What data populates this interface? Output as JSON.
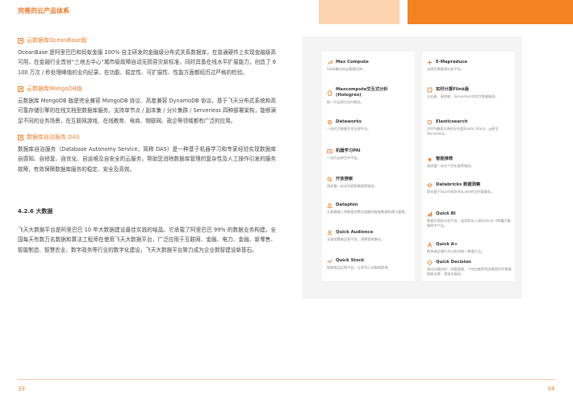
{
  "header": {
    "title": "完善的云产品体系"
  },
  "colors": {
    "accent": "#f07c28",
    "panel_bg": "#f4f4f4"
  },
  "left_column": {
    "sections": [
      {
        "heading": "云数据库OceanBase版",
        "body": "OceanBase 是阿里巴巴和蚂蚁金服 100% 自主研发的金融级分布式关系数据库，在普通硬件上实现金融级高可用，在金融行业首创“三地五中心”城市级故障自动无损容灾新标准，同时具备在线水平扩展能力，创造了 6100 万次 / 秒处理峰值的业内纪录，在功能、稳定性、可扩展性、性能方面都经历过严格的检验。"
      },
      {
        "heading": "云数据库MongoDB版",
        "body": "云数据库 MongoDB 版是完全兼容 MongoDB 协议、高度兼容 DynamoDB 协议，基于飞天分布式系统和高可靠存储引擎的在线文档型数据库服务，支持单节点 / 副本集 / 分片集群 / Serverless 四种部署架构，能够满足不同的业务场景，在互联网游戏、在线教育、电商、物联网、政企等领域都有广泛的应用。"
      },
      {
        "heading": "数据库自治服务 DAS",
        "body": "数据库自治服务（Database Autonomy Service，简称 DAS）是一种基于机器学习和专家经验实现数据库自感知、自修复、自优化、自运维及自安全的云服务，帮助您消除数据库管理的复杂性及人工操作引发的服务故障，有效保障数据库服务的稳定、安全及高效。"
      }
    ],
    "subsection": {
      "title": "4.2.6 大数据",
      "body": "飞天大数据平台是阿里巴巴 10 年大数据建设最佳实践的结晶。它承载了阿里巴巴 99% 的数据业务构建。全国每天有数万名数据和算法工程师在使用飞天大数据平台，广泛应用于互联网、金融、电力、金融、新零售、智能制造、智慧农业、数字政务等行业的数字化建设。飞天大数据平台致力成为企业数智建设新基石。"
    }
  },
  "products_left": [
    {
      "name": "Max Compute",
      "desc": "SaaS模式的云数据仓库。",
      "icon": "wrench-icon"
    },
    {
      "name": "Maxcompute交互式分析 (Hologres)",
      "desc": "新一代云原生实时数仓。",
      "icon": "database-icon"
    },
    {
      "name": "Dataworks",
      "desc": "一站式大数据开发治理平台。",
      "icon": "gear-icon"
    },
    {
      "name": "机器学习PAI",
      "desc": "一站式云原生AI平台。",
      "icon": "ml-icon"
    },
    {
      "name": "开放搜索",
      "desc": "高质量一站式内容智能搜索服务。",
      "icon": "search-icon"
    },
    {
      "name": "Dataphin",
      "desc": "从数据输入到数据消费全链路的智能数据构建与管理。",
      "icon": "flask-icon"
    },
    {
      "name": "Quick Audience",
      "desc": "全域消费者运营平台，洞察营销增长。",
      "icon": "audience-icon"
    },
    {
      "name": "Quick Stock",
      "desc": "智能商品运营平台，让更为心动电商简单。",
      "icon": "stock-icon"
    }
  ],
  "products_right": [
    {
      "name": "E-Mapreduce",
      "desc": "云原生数据湖分析平台。",
      "icon": "mapreduce-icon"
    },
    {
      "name": "实时计算Flink版",
      "desc": "企业级、高性能、Serverless实时大数据服务。",
      "icon": "flink-icon"
    },
    {
      "name": "Elasticsearch",
      "desc": "100%兼容开源的全托管Elastic Stack。云原生Serverless。",
      "icon": "elastic-icon"
    },
    {
      "name": "智能推荐",
      "desc": "高质量一站式个性化推荐服务。",
      "icon": "recommend-icon"
    },
    {
      "name": "Databricks 数据洞察",
      "desc": "简化基于Spark和DeltaLake的全托管服务。",
      "icon": "databricks-icon"
    },
    {
      "name": "Quick BI",
      "desc": "数据可视化分析平台，连续两年入选Gartner ABI魔力象限的中产品。",
      "icon": "bi-icon"
    },
    {
      "name": "Quick A+",
      "desc": "跨多端全域行为分析的统一数据产品。",
      "icon": "aplus-icon"
    },
    {
      "name": "Quick Decision",
      "desc": "面向全融风控、财富管理、个性化推荐等场景提供大数据智能决策、营销及服务。",
      "icon": "decision-icon"
    }
  ],
  "footer": {
    "page_left": "33",
    "page_right": "34"
  }
}
